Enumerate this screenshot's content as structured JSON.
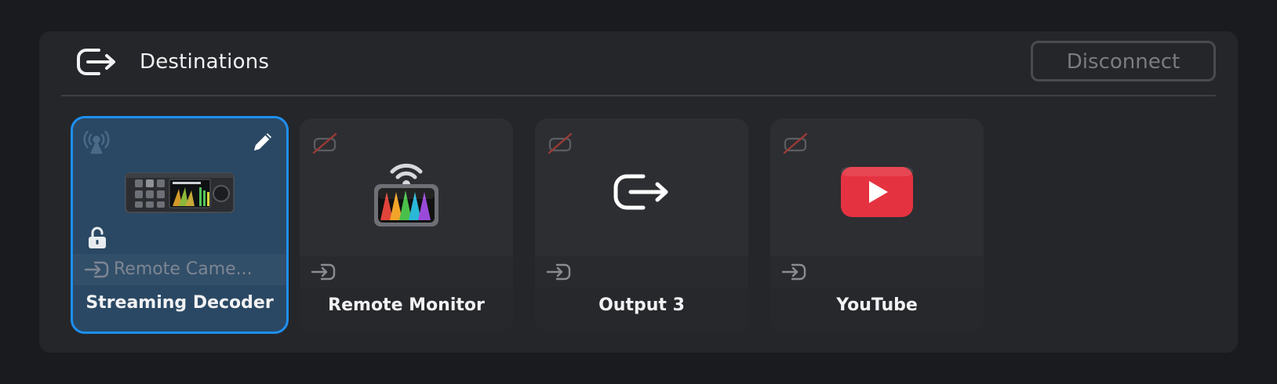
{
  "header": {
    "title": "Destinations",
    "icon": "output-arrow-icon",
    "disconnect_label": "Disconnect"
  },
  "colors": {
    "background": "#1a1b1e",
    "panel": "#252629",
    "card": "#2d2e32",
    "selected_card": "#2a4863",
    "selected_border": "#1e8ff2",
    "disconnected_slash": "#c0392b",
    "youtube_red": "#e53240"
  },
  "destinations": [
    {
      "name": "Streaming Decoder",
      "source": "Remote Came...",
      "selected": true,
      "status_icon": "broadcast-icon",
      "preview_icon": "streaming-decoder-device-icon",
      "locked": true
    },
    {
      "name": "Remote Monitor",
      "source": "",
      "selected": false,
      "status_icon": "disconnected-icon",
      "preview_icon": "remote-monitor-icon"
    },
    {
      "name": "Output 3",
      "source": "",
      "selected": false,
      "status_icon": "disconnected-icon",
      "preview_icon": "output-arrow-icon"
    },
    {
      "name": "YouTube",
      "source": "",
      "selected": false,
      "status_icon": "disconnected-icon",
      "preview_icon": "youtube-icon"
    }
  ]
}
